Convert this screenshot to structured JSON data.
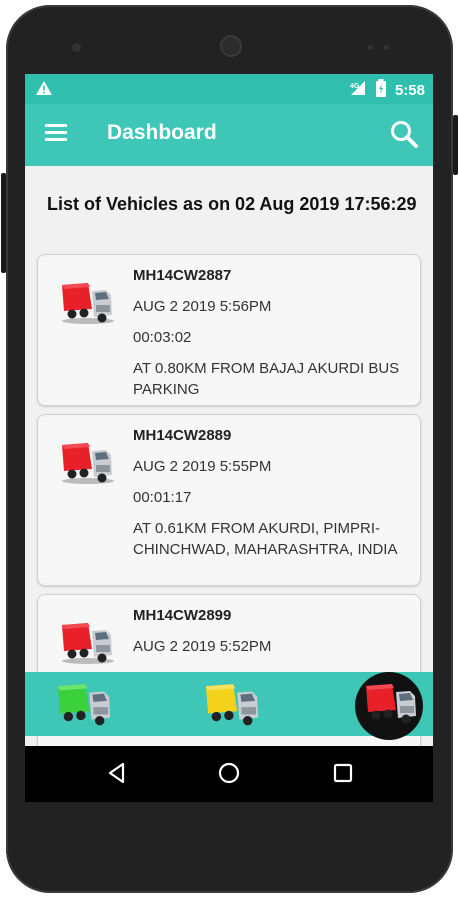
{
  "status_bar": {
    "time": "5:58",
    "icons": [
      "warning-icon",
      "signal-icon",
      "battery-icon"
    ]
  },
  "app_bar": {
    "title": "Dashboard",
    "menu_icon": "menu-icon",
    "search_icon": "search-icon"
  },
  "list": {
    "header": "List of Vehicles as on  02 Aug 2019 17:56:29",
    "vehicles": [
      {
        "id": "MH14CW2887",
        "datetime": "AUG  2 2019   5:56PM",
        "duration": "00:03:02",
        "location": "AT 0.80KM FROM BAJAJ AKURDI BUS PARKING",
        "truck_color": "red"
      },
      {
        "id": "MH14CW2889",
        "datetime": "AUG  2 2019   5:55PM",
        "duration": "00:01:17",
        "location": "AT 0.61KM FROM AKURDI, PIMPRI-CHINCHWAD, MAHARASHTRA, INDIA",
        "truck_color": "red"
      },
      {
        "id": "MH14CW2899",
        "datetime": "AUG  2 2019   5:52PM",
        "duration": "",
        "location": "",
        "truck_color": "red"
      }
    ]
  },
  "bottom_nav": {
    "items": [
      {
        "name": "green-truck",
        "color": "#3ad13a"
      },
      {
        "name": "yellow-truck",
        "color": "#f2d21b"
      },
      {
        "name": "red-truck",
        "color": "#e8202a",
        "active": true
      }
    ]
  },
  "colors": {
    "accent": "#3ec6b6",
    "status_bar": "#30bfae",
    "truck_red": "#e8202a",
    "truck_green": "#3ad13a",
    "truck_yellow": "#f2d21b"
  }
}
